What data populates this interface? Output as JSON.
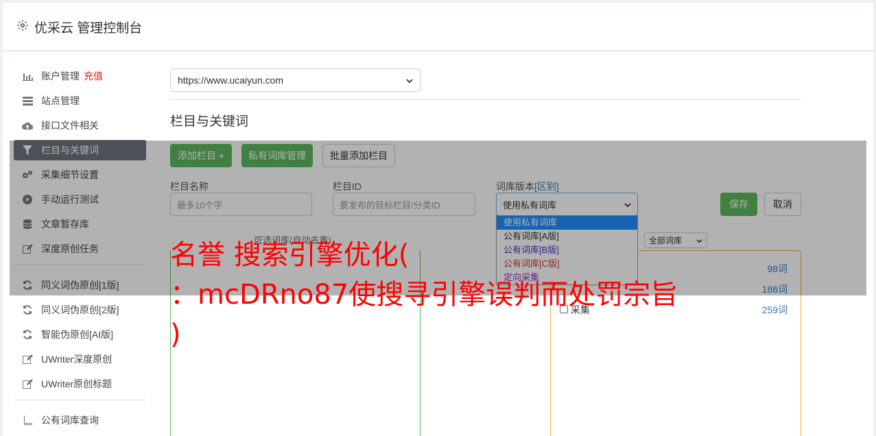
{
  "header": {
    "title": "优采云 管理控制台",
    "icon": "gear-icon"
  },
  "sidebar": {
    "group1": [
      {
        "label": "账户管理",
        "badge": "充值",
        "icon": "bar-chart-icon"
      },
      {
        "label": "站点管理",
        "icon": "server-icon"
      },
      {
        "label": "接口文件相关",
        "icon": "cloud-upload-icon"
      },
      {
        "label": "栏目与关键词",
        "icon": "filter-icon",
        "active": true
      },
      {
        "label": "采集细节设置",
        "icon": "gears-icon"
      },
      {
        "label": "手动运行测试",
        "icon": "play-circle-icon"
      },
      {
        "label": "文章暂存库",
        "icon": "database-icon"
      },
      {
        "label": "深度原创任务",
        "icon": "edit-icon"
      }
    ],
    "group2": [
      {
        "label": "同义词伪原创[1版]",
        "icon": "refresh-icon"
      },
      {
        "label": "同义词伪原创[2版]",
        "icon": "refresh-icon"
      },
      {
        "label": "智能伪原创[AI版]",
        "icon": "refresh-icon"
      },
      {
        "label": "UWriter深度原创",
        "icon": "edit-icon"
      },
      {
        "label": "UWriter原创标题",
        "icon": "edit-icon"
      }
    ],
    "group3": [
      {
        "label": "公有词库查询",
        "icon": "book-icon"
      }
    ]
  },
  "main": {
    "site_select": "https://www.ucaiyun.com",
    "section_title": "栏目与关键词",
    "buttons": {
      "add": "添加栏目 +",
      "private_lib": "私有词库管理",
      "batch_add": "批量添加栏目",
      "save": "保存",
      "cancel": "取消"
    },
    "fields": {
      "name_label": "栏目名称",
      "name_placeholder": "最多10个字",
      "id_label": "栏目ID",
      "id_placeholder": "要发布的目标栏目/分类ID",
      "version_label": "词库版本",
      "version_label_link": "[区别]",
      "version_value": "使用私有词库"
    },
    "version_options": [
      {
        "label": "使用私有词库",
        "color": "#ffffff"
      },
      {
        "label": "公有词库[A版]",
        "color": "#333333"
      },
      {
        "label": "公有词库[B版]",
        "color": "#3333cc"
      },
      {
        "label": "公有词库[C版]",
        "color": "#cc3333"
      },
      {
        "label": "定向采集",
        "color": "#9933cc"
      }
    ],
    "left_box_label": "可选词库(自动去重)",
    "lib_filter": "全部词库",
    "libraries": [
      {
        "label": "",
        "count": "98词"
      },
      {
        "label": "",
        "count": "186词"
      },
      {
        "label": "采集",
        "count": "259词"
      }
    ]
  },
  "watermark": {
    "line1": "名誉 搜索引擎优化(",
    "line2": "：mcDRno87使搜寻引擎误判而处罚宗旨",
    "line3": ")"
  }
}
